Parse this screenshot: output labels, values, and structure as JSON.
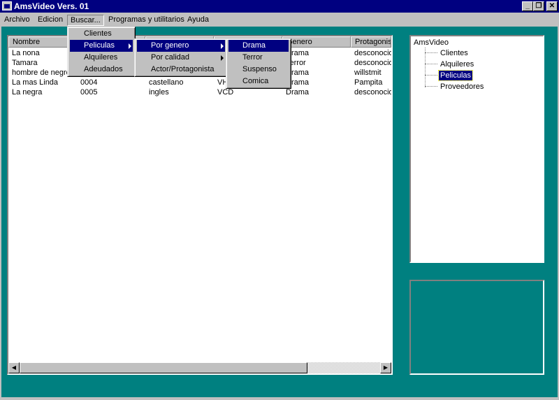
{
  "window": {
    "title": "AmsVideo Vers. 01"
  },
  "menubar": [
    "Archivo",
    "Edicion",
    "Buscar...",
    "Programas y utilitarios",
    "Ayuda"
  ],
  "menus": {
    "buscar": [
      "Clientes",
      "Peliculas",
      "Alquileres",
      "Adeudados"
    ],
    "peliculas": [
      "Por genero",
      "Por calidad",
      "Actor/Protagonista"
    ],
    "por_genero": [
      "Drama",
      "Terror",
      "Suspenso",
      "Comica"
    ]
  },
  "list": {
    "columns": [
      "Nombre",
      "",
      "",
      "",
      "Genero",
      "Protagonis"
    ],
    "rows": [
      [
        "La nona",
        "",
        "",
        "",
        "Drama",
        "desconocid"
      ],
      [
        "Tamara",
        "",
        "",
        "",
        "Terror",
        "desconocid"
      ],
      [
        "hombre de negro",
        "",
        "",
        "",
        "Drama",
        "willstmit"
      ],
      [
        "La mas Linda",
        "0004",
        "castellano",
        "VHS",
        "Drama",
        "Pampita"
      ],
      [
        "La negra",
        "0005",
        "ingles",
        "VCD",
        "Drama",
        "desconocid"
      ]
    ]
  },
  "tree": {
    "root": "AmsVideo",
    "children": [
      "Clientes",
      "Alquileres",
      "Peliculas",
      "Proveedores"
    ],
    "selected_index": 2
  },
  "colors": {
    "desktop": "#008080",
    "titlebar": "#000080",
    "face": "#c0c0c0",
    "highlight": "#000080"
  }
}
